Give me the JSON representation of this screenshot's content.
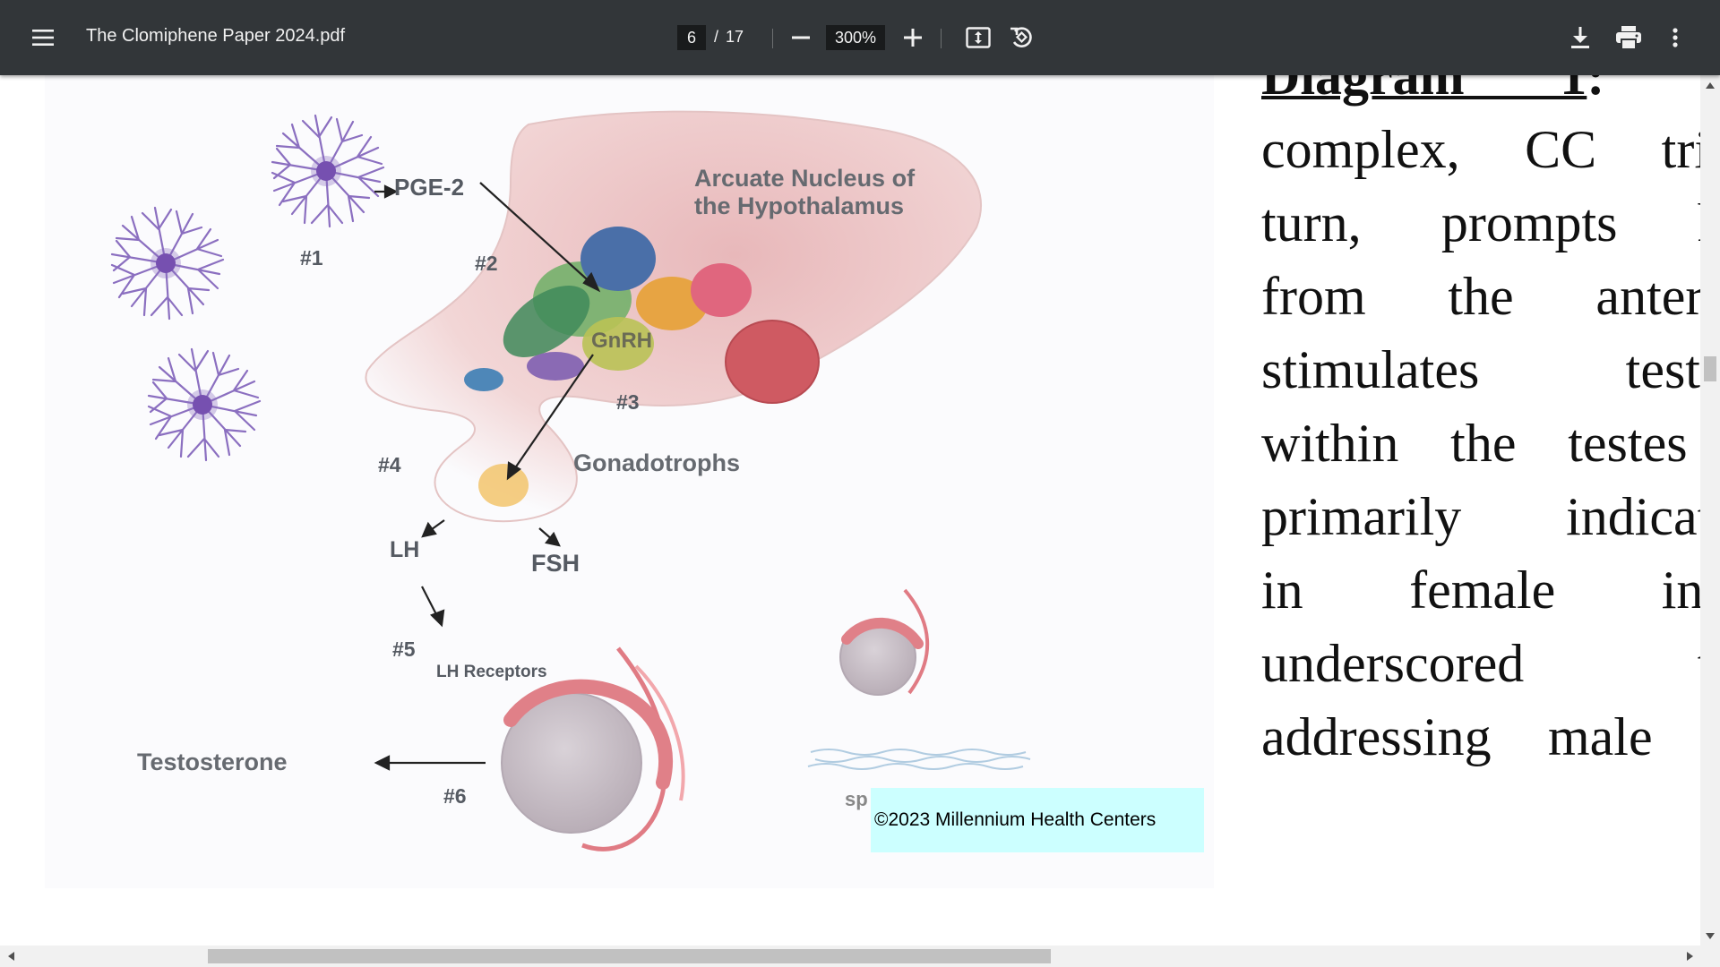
{
  "toolbar": {
    "title": "The Clomiphene Paper 2024.pdf",
    "current_page": "6",
    "page_separator": "/",
    "total_pages": "17",
    "zoom": "300%",
    "icons": {
      "menu": "hamburger-menu-icon",
      "zoom_out": "minus-icon",
      "zoom_in": "plus-icon",
      "fit": "fit-to-page-icon",
      "rotate": "rotate-counterclockwise-icon",
      "download": "download-icon",
      "print": "print-icon",
      "more": "more-vertical-icon"
    },
    "background": "#323639"
  },
  "figure": {
    "labels": {
      "arcuate_1": "Arcuate Nucleus of",
      "arcuate_2": "the Hypothalamus",
      "pge2": "PGE-2",
      "n1": "#1",
      "n2": "#2",
      "gnrh": "GnRH",
      "n3": "#3",
      "n4": "#4",
      "gonadotrophs": "Gonadotrophs",
      "lh": "LH",
      "fsh": "FSH",
      "n5": "#5",
      "lh_receptors": "LH Receptors",
      "testosterone": "Testosterone",
      "n6": "#6",
      "sp": "sp"
    },
    "copyright": "©2023 Millennium Health Centers",
    "copyright_bg": "#ccffff"
  },
  "page_text": {
    "heading": "Diagram 1",
    "heading_rest": ":  By",
    "lines": [
      "complex, CC trigg",
      "turn, prompts hei",
      "from the anterior",
      "stimulates testost",
      "within the testes a",
      "primarily indicated",
      "in female infer",
      "underscored the",
      "addressing male hy"
    ]
  }
}
